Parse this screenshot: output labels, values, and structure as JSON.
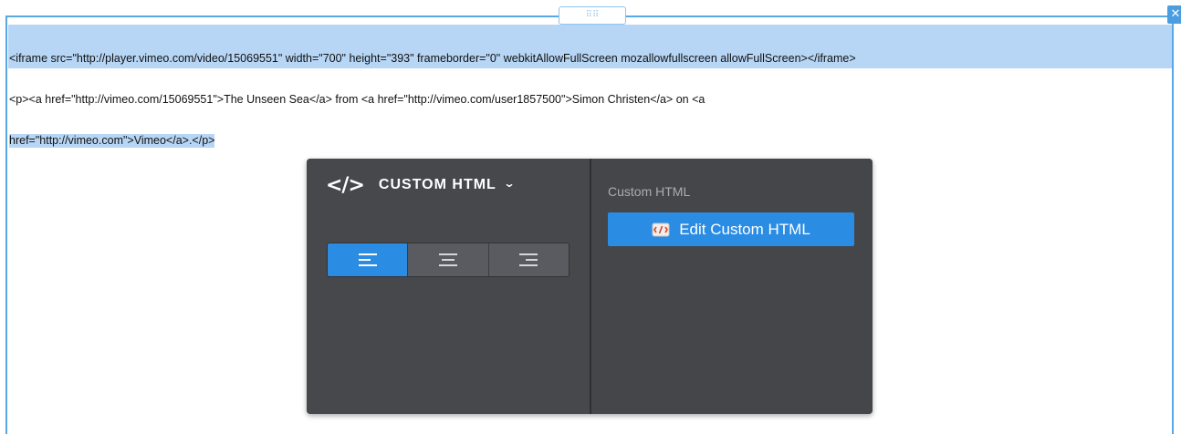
{
  "editor": {
    "embed_code_lines": [
      "<iframe src=\"http://player.vimeo.com/video/15069551\" width=\"700\" height=\"393\" frameborder=\"0\" webkitAllowFullScreen mozallowfullscreen allowFullScreen></iframe>",
      "<p><a href=\"http://vimeo.com/15069551\">The Unseen Sea</a> from <a href=\"http://vimeo.com/user1857500\">Simon Christen</a> on <a",
      "href=\"http://vimeo.com\">Vimeo</a>.</p>"
    ],
    "drag_handle_glyph": "⠿⠿",
    "close_glyph": "✕"
  },
  "widget": {
    "icon_glyph": "</>",
    "title": "CUSTOM HTML",
    "dropdown_glyph": "⌄",
    "alignment_options": [
      "left",
      "center",
      "right"
    ],
    "active_alignment": "left",
    "section_label": "Custom HTML",
    "edit_button_label": "Edit Custom HTML"
  },
  "colors": {
    "selection_border": "#58a7e6",
    "text_highlight": "#b7d6f5",
    "panel_background": "#46484c",
    "accent_blue": "#2b8ce3"
  }
}
